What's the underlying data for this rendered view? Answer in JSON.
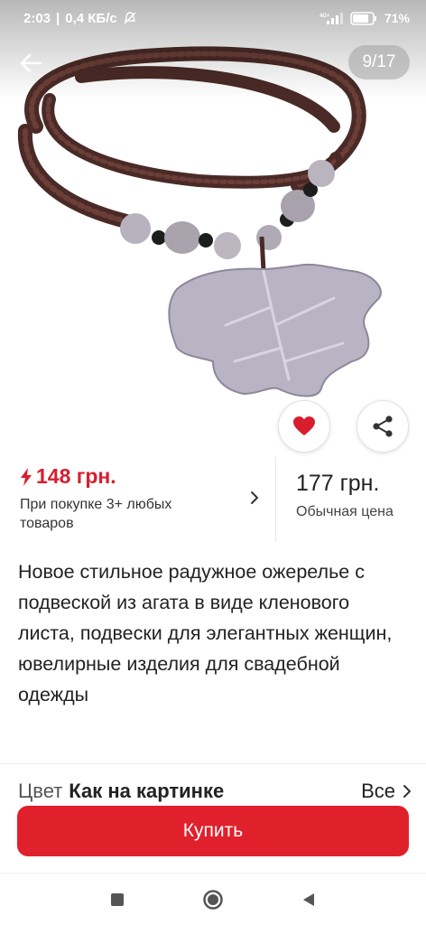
{
  "status_bar": {
    "time": "2:03",
    "speed": "0,4 КБ/с",
    "network": "4G+",
    "battery": "71%"
  },
  "gallery": {
    "counter": "9/17"
  },
  "price": {
    "promo_price": "148 грн.",
    "promo_condition": "При покупке 3+ любых товаров",
    "regular_price": "177 грн.",
    "regular_label": "Обычная цена"
  },
  "product": {
    "title": "Новое стильное радужное ожерелье с подвеской из агата в виде кленового листа, подвески для элегантных женщин, ювелирные изделия для свадебной одежды"
  },
  "variant": {
    "label": "Цвет",
    "value": "Как на картинке",
    "all_label": "Все"
  },
  "actions": {
    "buy_label": "Купить"
  },
  "colors": {
    "accent": "#e0202b",
    "promo": "#d81e2e",
    "cord": "#4a2a26",
    "agate": "#b9b4c4"
  }
}
